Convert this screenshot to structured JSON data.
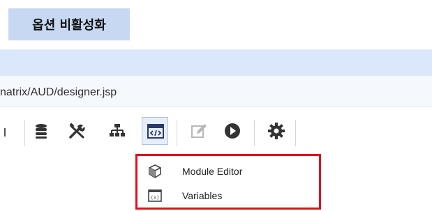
{
  "caption": "옵션 비활성화",
  "address_bar": {
    "url": "natrix/AUD/designer.jsp"
  },
  "toolbar": {
    "icons": [
      "database-icon",
      "tools-icon",
      "sitemap-icon",
      "code-icon",
      "edit-icon",
      "play-icon",
      "gear-icon"
    ],
    "active_icon": "code-icon",
    "disabled_icon": "edit-icon"
  },
  "dropdown": {
    "items": [
      {
        "label": "Module Editor",
        "icon": "cube-icon"
      },
      {
        "label": "Variables",
        "icon": "variable-icon"
      }
    ],
    "highlight_color": "#e0101d"
  },
  "colors": {
    "caption_bg": "#c7d9f2",
    "band_bg": "#dbe7fb",
    "active_button_bg": "#e6eefb",
    "icon_color": "#333333"
  }
}
